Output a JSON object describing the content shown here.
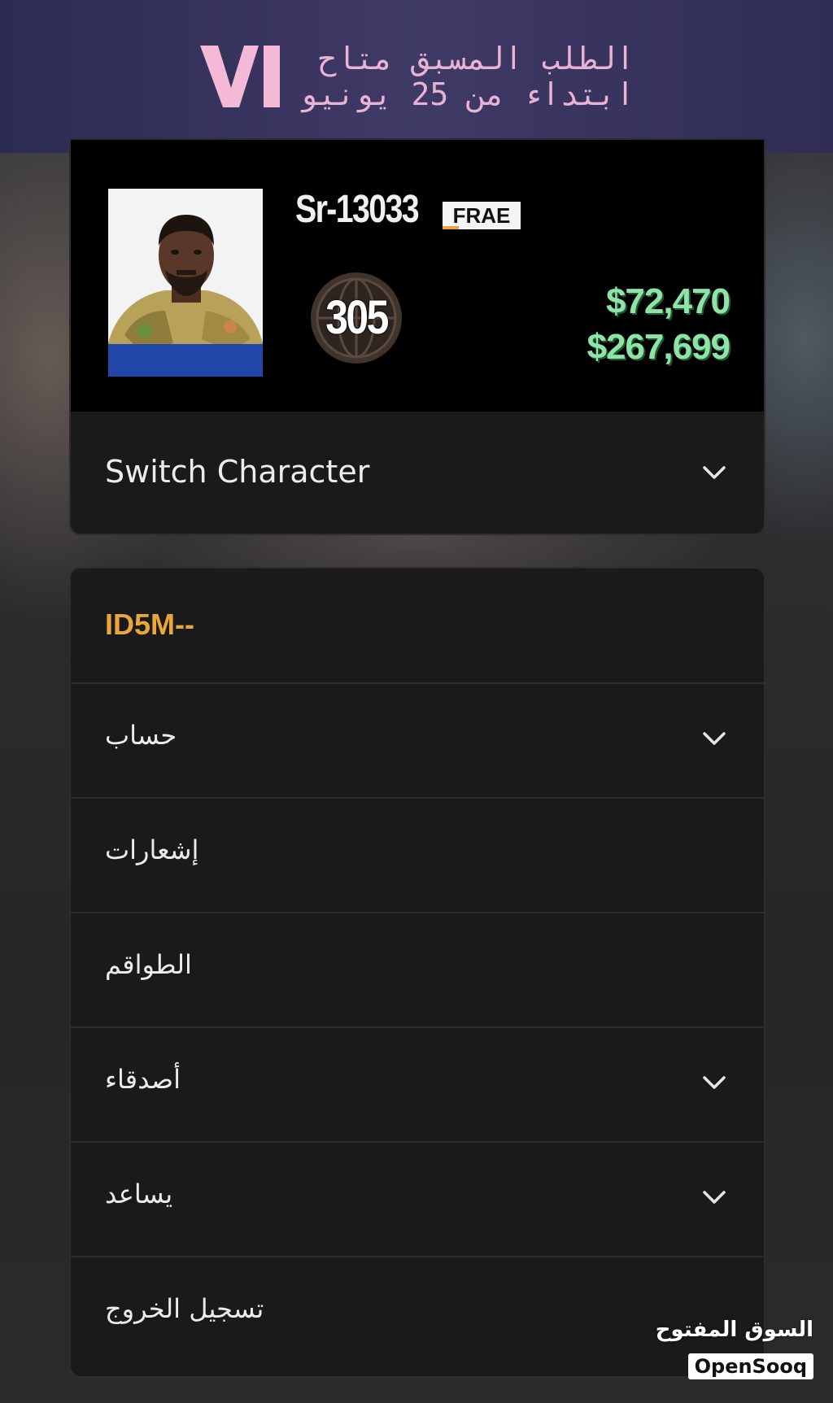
{
  "banner": {
    "logo": "VI",
    "line1": "الطلب المسبق متاح",
    "line2": "ابتداء من 25 يونيو"
  },
  "character": {
    "name": "Sr-13033",
    "crew_tag": "FRAE",
    "rank": "305",
    "cash": "$72,470",
    "bank": "$267,699",
    "switch_label": "Switch Character"
  },
  "menu": {
    "user_id": "ID5M--",
    "items": [
      {
        "label": "حساب",
        "expandable": true
      },
      {
        "label": "إشعارات",
        "expandable": false
      },
      {
        "label": "الطواقم",
        "expandable": false
      },
      {
        "label": "أصدقاء",
        "expandable": true
      },
      {
        "label": "يساعد",
        "expandable": true
      },
      {
        "label": "تسجيل الخروج",
        "expandable": false
      }
    ]
  },
  "watermark": {
    "arabic": "السوق المفتوح",
    "logo_text": "OpenSooq"
  },
  "colors": {
    "banner_bg": "#3a3663",
    "banner_text": "#e9b3d4",
    "money_green": "#8fe3a7",
    "accent_orange": "#e8a73a",
    "card_bg": "#1a1a1b",
    "avatar_base": "#1f46a8"
  },
  "icons": {
    "chevron": "chevron-down-icon",
    "rank": "rank-globe-icon"
  }
}
